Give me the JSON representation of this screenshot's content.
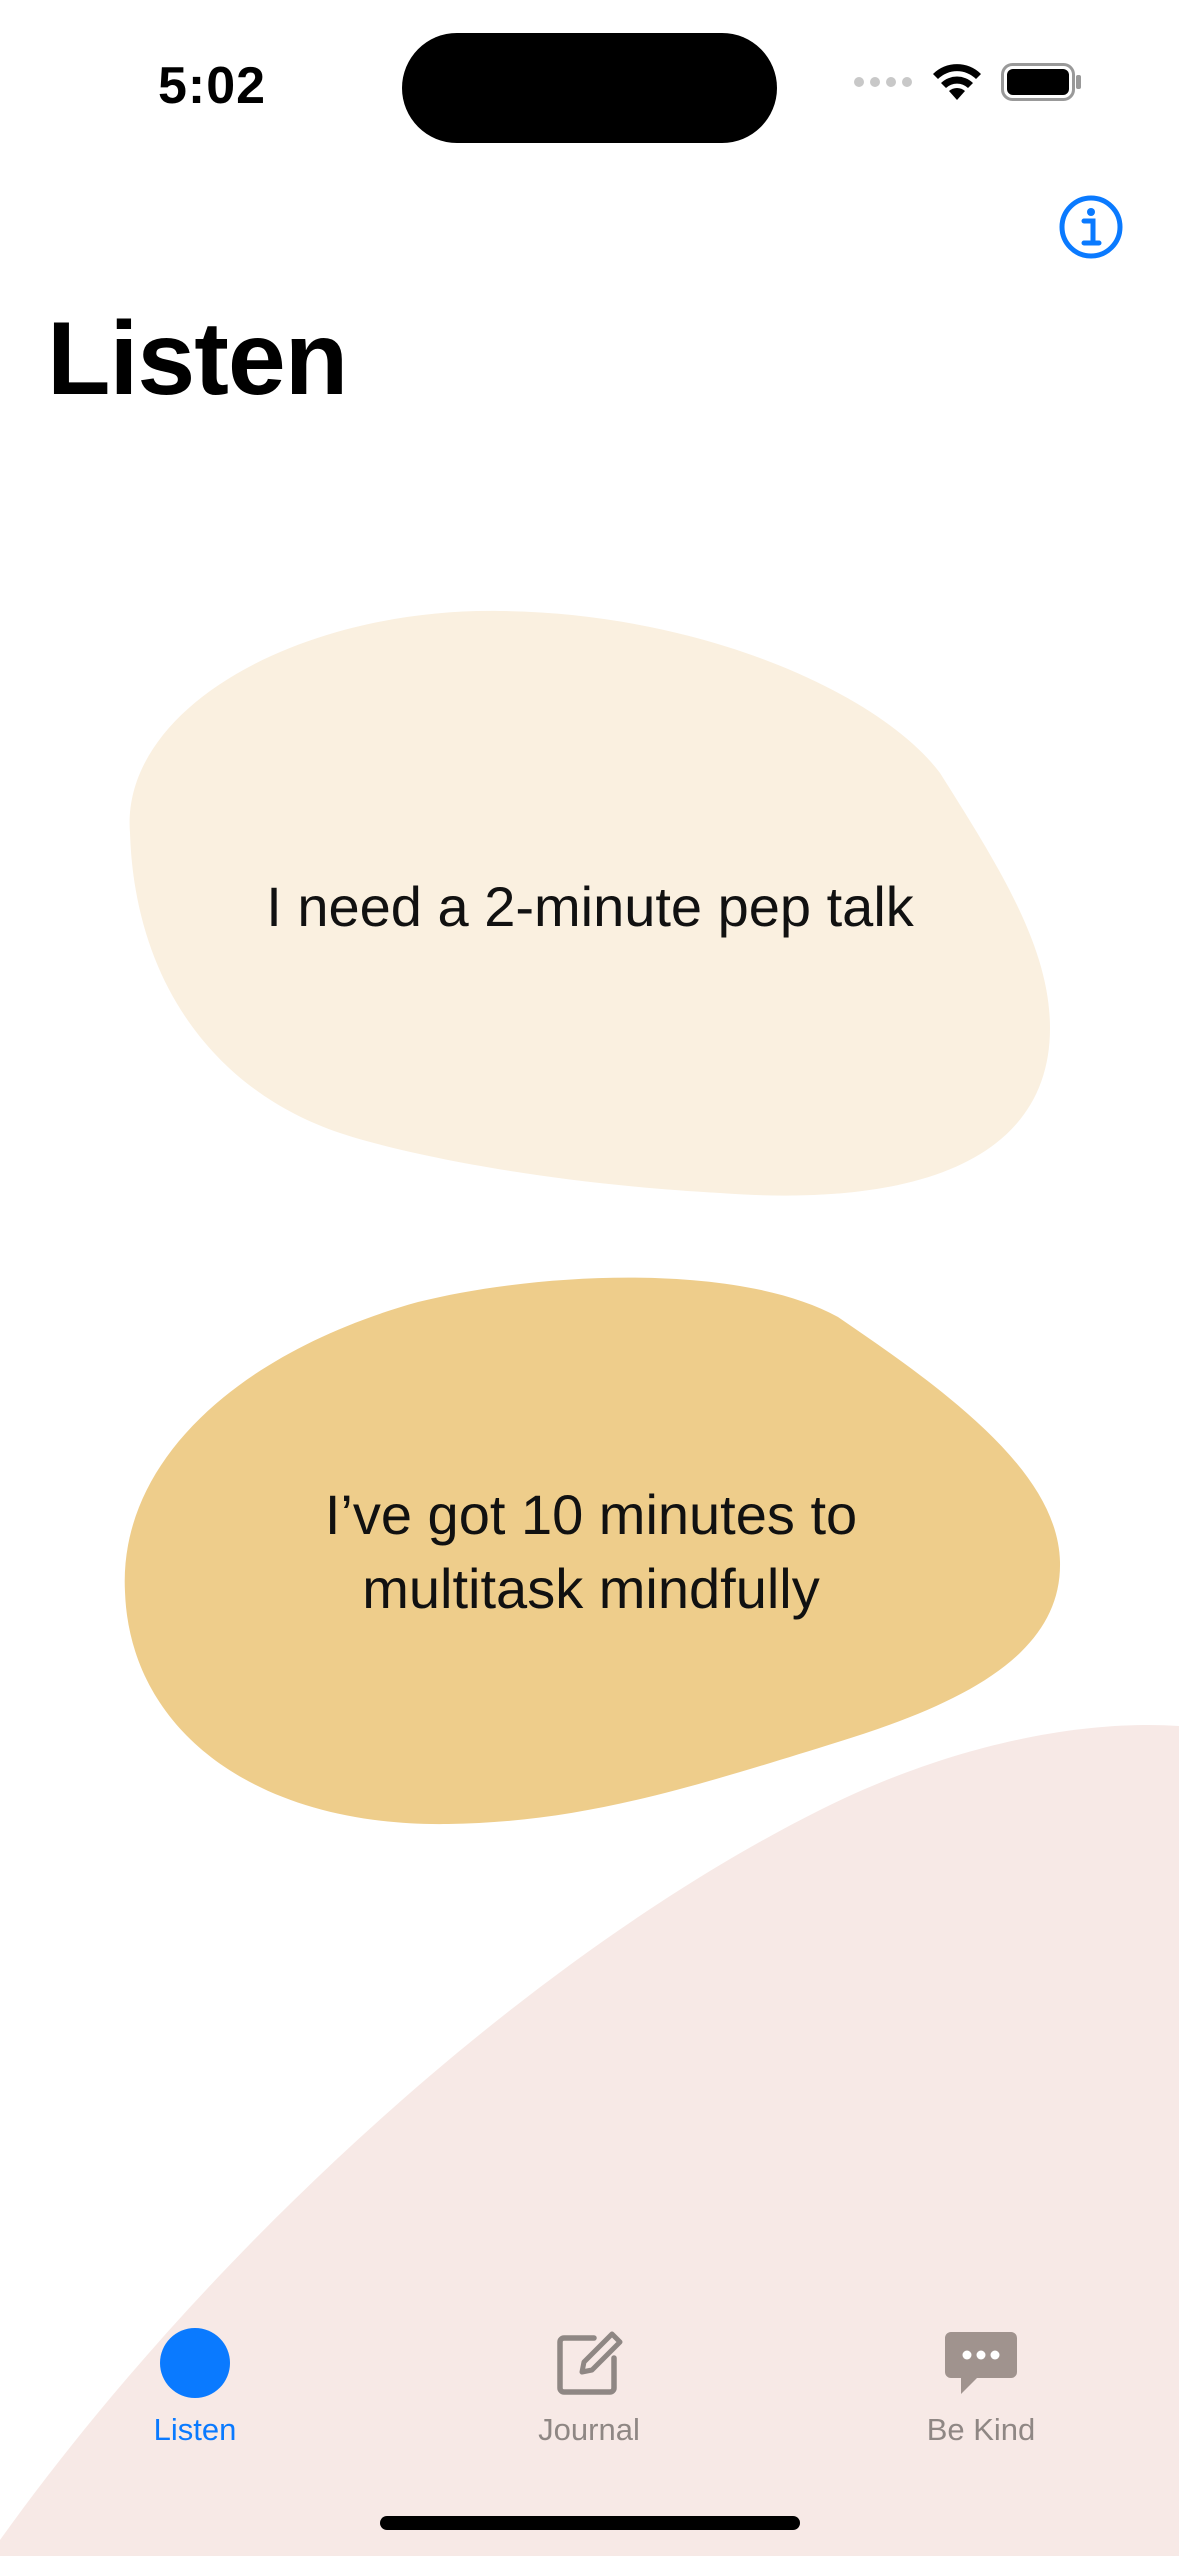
{
  "status_bar": {
    "time": "5:02",
    "icons": [
      "signal-dots-icon",
      "wifi-icon",
      "battery-icon"
    ]
  },
  "nav": {
    "title": "Listen",
    "info_icon": "info-circle-icon"
  },
  "options": [
    {
      "label": "I need a 2-minute pep talk",
      "color": "#faf0e0"
    },
    {
      "label": "I’ve got 10 minutes to\nmultitask mindfully",
      "color": "#eecd8b"
    }
  ],
  "tab_bar": {
    "selected": "Listen",
    "tabs": [
      {
        "label": "Listen",
        "icon": "blue-circle-icon"
      },
      {
        "label": "Journal",
        "icon": "compose-icon"
      },
      {
        "label": "Be Kind",
        "icon": "speech-bubble-icon"
      }
    ]
  },
  "colors": {
    "accent": "#0a7aff",
    "background_shape": "#f7e9e6",
    "inactive_tab": "#8f8784"
  }
}
